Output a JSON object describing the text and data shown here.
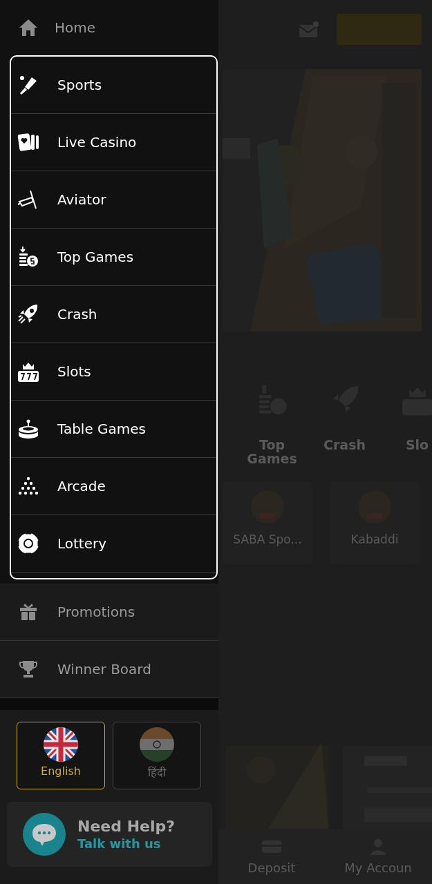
{
  "drawer": {
    "home": {
      "label": "Home"
    },
    "menu": [
      {
        "label": "Sports"
      },
      {
        "label": "Live Casino"
      },
      {
        "label": "Aviator"
      },
      {
        "label": "Top Games"
      },
      {
        "label": "Crash"
      },
      {
        "label": "Slots"
      },
      {
        "label": "Table Games"
      },
      {
        "label": "Arcade"
      },
      {
        "label": "Lottery"
      }
    ],
    "secondary": [
      {
        "label": "Promotions"
      },
      {
        "label": "Winner Board"
      }
    ],
    "languages": [
      {
        "label": "English",
        "selected": true
      },
      {
        "label": "हिंदी",
        "selected": false
      }
    ],
    "help": {
      "title": "Need Help?",
      "link": "Talk with us"
    }
  },
  "background_page": {
    "categories": [
      {
        "label": "Top Games"
      },
      {
        "label": "Crash"
      },
      {
        "label": "Slo"
      }
    ],
    "games": [
      {
        "label": "SABA Spo..."
      },
      {
        "label": "Kabaddi"
      }
    ],
    "bottom_nav": [
      {
        "label": "Deposit"
      },
      {
        "label": "My Accoun"
      }
    ]
  }
}
